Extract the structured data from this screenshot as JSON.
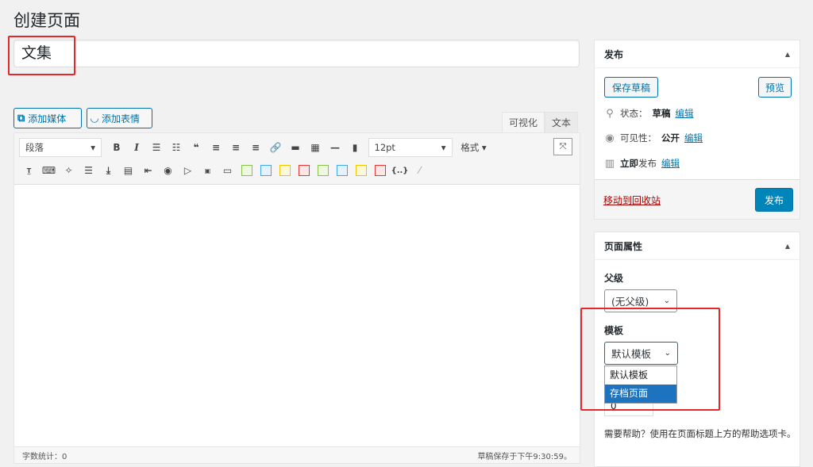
{
  "page_title": "创建页面",
  "post_title": "文集",
  "media_buttons": {
    "add_media": "添加媒体",
    "add_emoji": "添加表情"
  },
  "editor_tabs": {
    "visual": "可视化",
    "text": "文本"
  },
  "toolbar": {
    "format_select": "段落",
    "font_size": "12pt",
    "styles": "格式"
  },
  "status_bar": {
    "word_count": "字数统计：0",
    "autosave": "草稿保存于下午9:30:59。"
  },
  "publish_box": {
    "title": "发布",
    "save_draft": "保存草稿",
    "preview": "预览",
    "status_label": "状态：",
    "status_value": "草稿",
    "visibility_label": "可见性：",
    "visibility_value": "公开",
    "schedule_prefix": "立即",
    "schedule_suffix": "发布",
    "edit": "编辑",
    "trash": "移动到回收站",
    "publish": "发布"
  },
  "page_attributes": {
    "title": "页面属性",
    "parent_label": "父级",
    "parent_value": "(无父级)",
    "template_label": "模板",
    "template_value": "默认模板",
    "template_options": [
      "默认模板",
      "存档页面"
    ],
    "order_value": "0",
    "help": "需要帮助？使用在页面标题上方的帮助选项卡。"
  },
  "colors": {
    "accent": "#0073aa",
    "primary_button": "#0085ba",
    "highlight_box": "#e5282c",
    "dropdown_selected": "#1e73be",
    "trash_link": "#aa0000"
  }
}
